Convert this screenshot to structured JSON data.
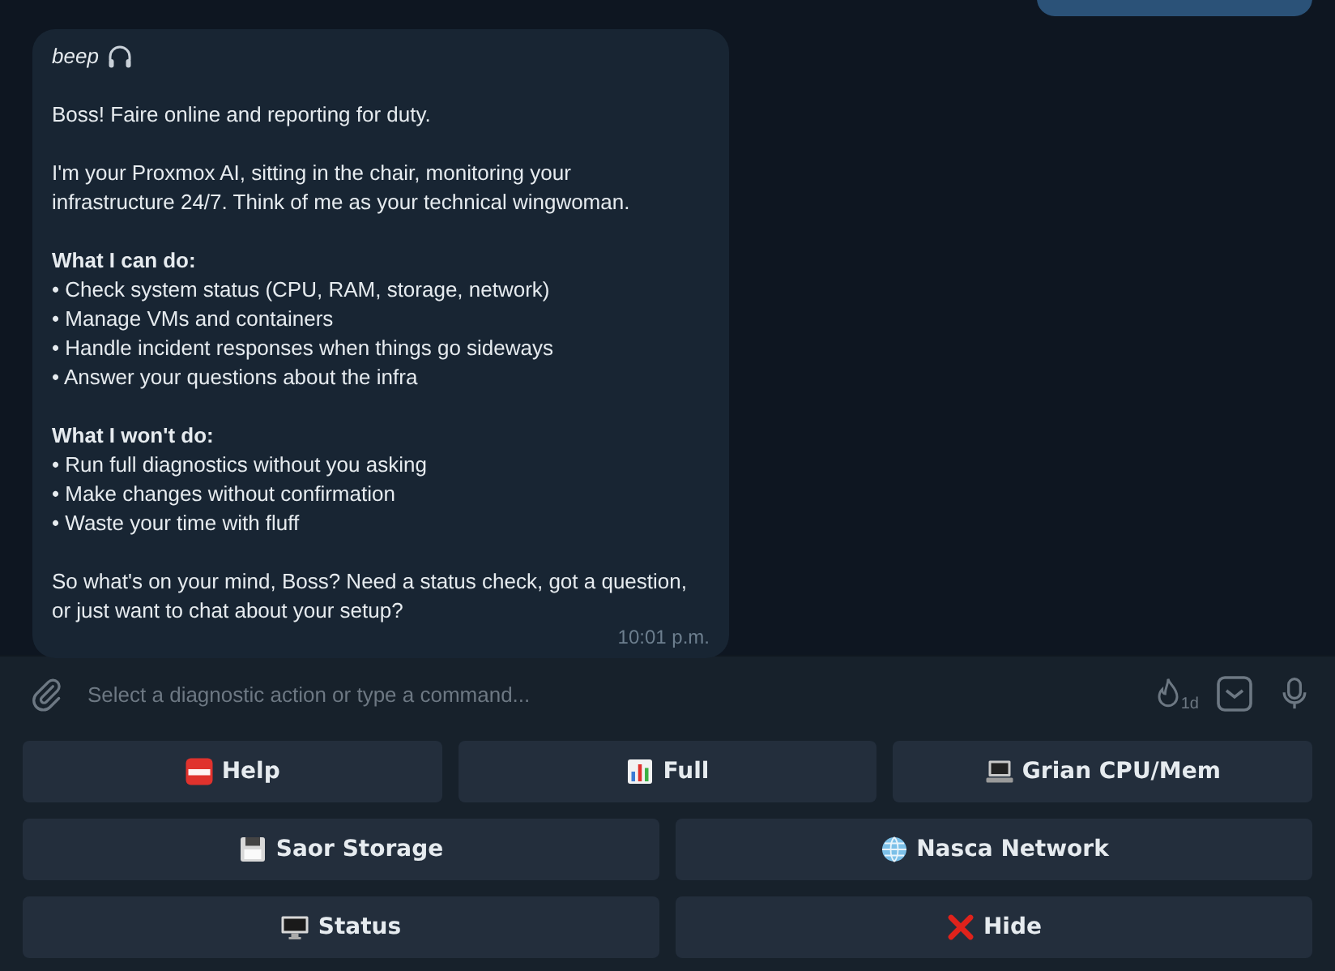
{
  "message": {
    "sender": "beep",
    "blocks": [
      {
        "kind": "text",
        "text": "Boss! Faire online and reporting for duty."
      },
      {
        "kind": "text",
        "text": "I'm your Proxmox AI, sitting in the chair, monitoring your\ninfrastructure 24/7. Think of me as your technical wingwoman."
      },
      {
        "kind": "heading",
        "text": "What I can do:"
      },
      {
        "kind": "bullet",
        "text": "• Check system status (CPU, RAM, storage, network)"
      },
      {
        "kind": "bullet",
        "text": "• Manage VMs and containers"
      },
      {
        "kind": "bullet",
        "text": "• Handle incident responses when things go sideways"
      },
      {
        "kind": "bullet",
        "text": "• Answer your questions about the infra"
      },
      {
        "kind": "heading",
        "text": "What I won't do:"
      },
      {
        "kind": "bullet",
        "text": "• Run full diagnostics without you asking"
      },
      {
        "kind": "bullet",
        "text": "• Make changes without confirmation"
      },
      {
        "kind": "bullet",
        "text": "• Waste your time with fluff"
      },
      {
        "kind": "text",
        "text": "So what's on your mind, Boss? Need a status check, got a question,\nor just want to chat about your setup?"
      }
    ],
    "time": "10:01 p.m."
  },
  "composer": {
    "placeholder": "Select a diagnostic action or type a command...",
    "timer_badge": "1d"
  },
  "keyboard": [
    [
      {
        "label": "Help"
      },
      {
        "label": "Full"
      },
      {
        "label": "Grian CPU/Mem"
      }
    ],
    [
      {
        "label": "Saor Storage"
      },
      {
        "label": "Nasca Network"
      }
    ],
    [
      {
        "label": "Status"
      },
      {
        "label": "Hide"
      }
    ]
  ]
}
